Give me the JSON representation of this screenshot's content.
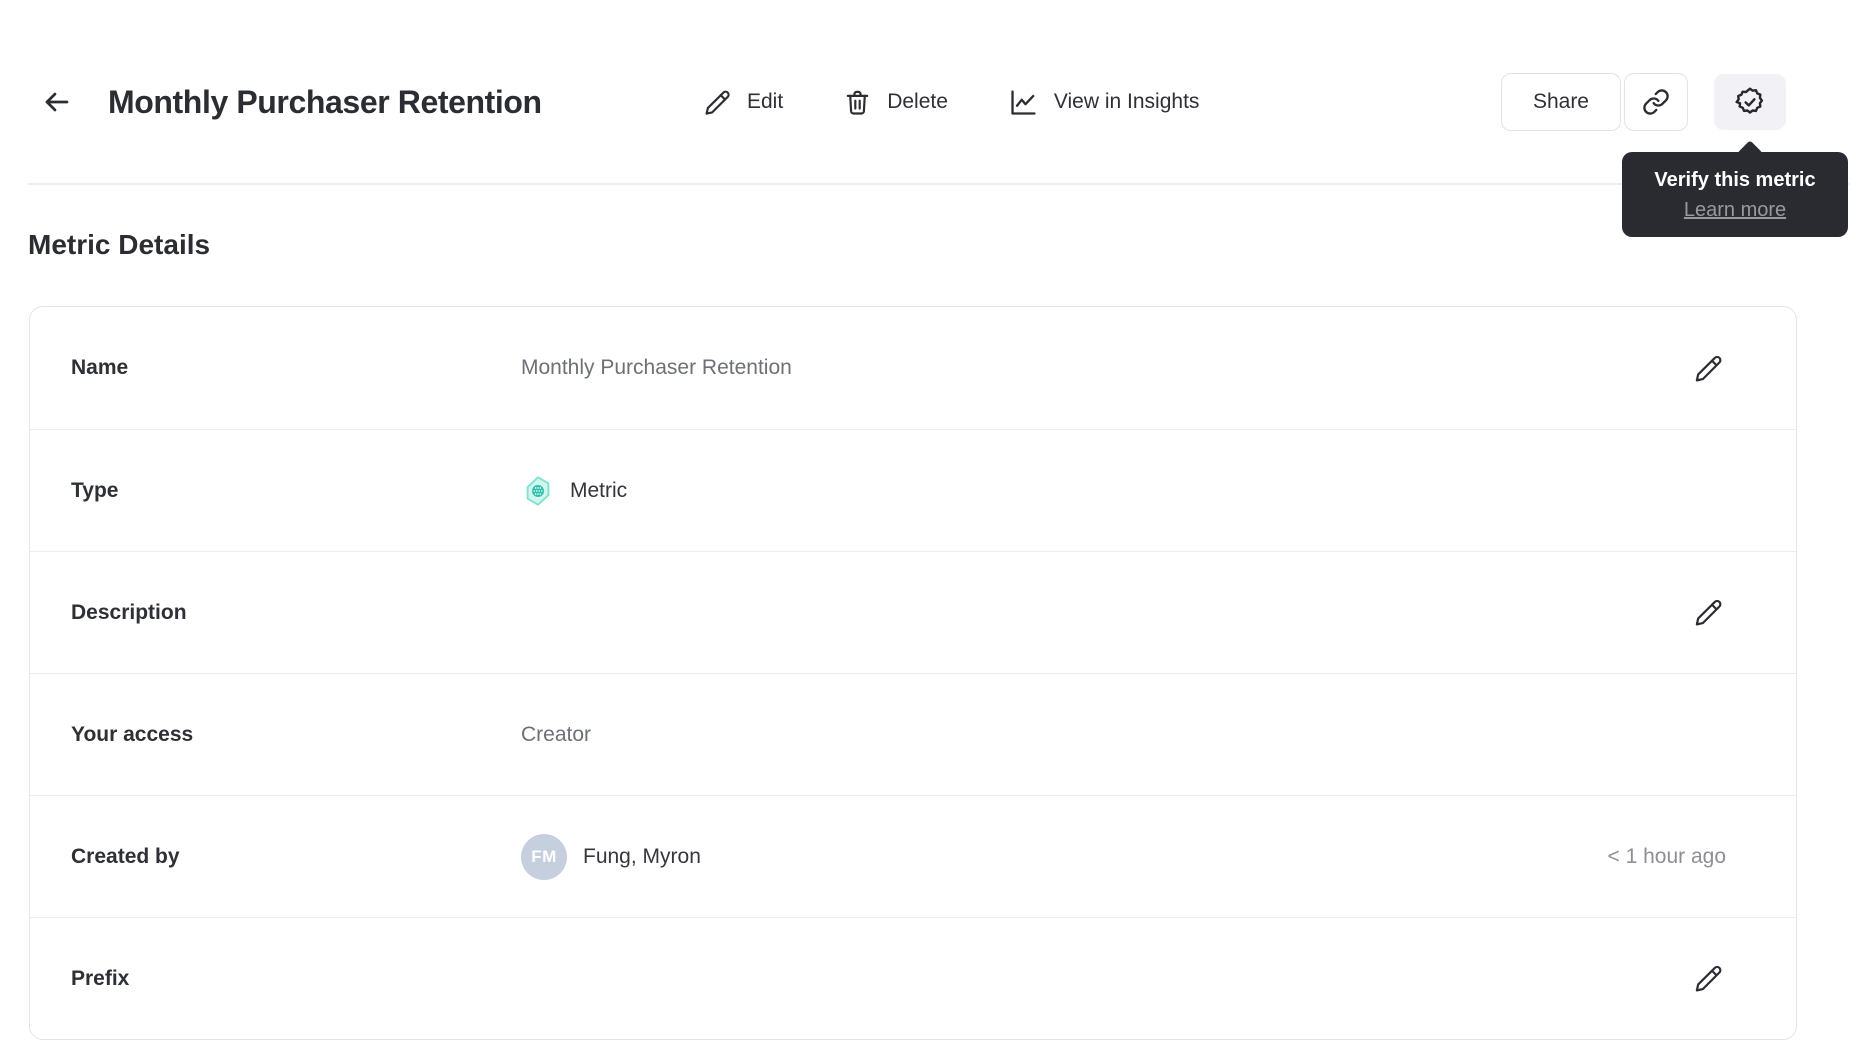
{
  "header": {
    "title": "Monthly Purchaser Retention",
    "actions": {
      "edit": "Edit",
      "delete": "Delete",
      "insights": "View in Insights",
      "share": "Share"
    }
  },
  "tooltip": {
    "title": "Verify this metric",
    "link": "Learn more"
  },
  "section": {
    "heading": "Metric Details"
  },
  "details": {
    "name": {
      "label": "Name",
      "value": "Monthly Purchaser Retention"
    },
    "type": {
      "label": "Type",
      "value": "Metric"
    },
    "description": {
      "label": "Description",
      "value": ""
    },
    "access": {
      "label": "Your access",
      "value": "Creator"
    },
    "created_by": {
      "label": "Created by",
      "avatar_initials": "FM",
      "value": "Fung, Myron",
      "timestamp": "< 1 hour ago"
    },
    "prefix": {
      "label": "Prefix",
      "value": ""
    }
  },
  "icons": {
    "back": "arrow-left",
    "edit": "pencil",
    "delete": "trash",
    "insights": "line-chart",
    "copy_link": "chain-link",
    "verify": "seal-check",
    "type_metric": "teal-hexagon",
    "row_edit": "pencil"
  },
  "colors": {
    "accent_teal": "#2fbfae",
    "accent_teal_light": "#d2f5ee",
    "avatar_bg": "#c5cfdd",
    "tooltip_bg": "#292b30",
    "divider": "#ececef"
  }
}
